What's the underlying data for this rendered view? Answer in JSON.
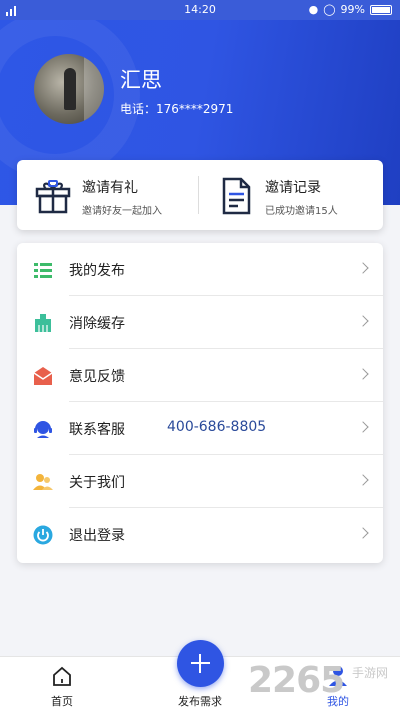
{
  "status_bar": {
    "time": "14:20",
    "battery": "99%"
  },
  "profile": {
    "name": "汇思",
    "phone": "电话：176****2971"
  },
  "invite": [
    {
      "title": "邀请有礼",
      "subtitle": "邀请好友一起加入",
      "icon": "gift-icon"
    },
    {
      "title": "邀请记录",
      "subtitle": "已成功邀请15人",
      "icon": "document-icon"
    }
  ],
  "menu": [
    {
      "label": "我的发布",
      "icon": "list-icon",
      "color": "#3dbb6a"
    },
    {
      "label": "消除缓存",
      "icon": "broom-icon",
      "color": "#3cbf9a"
    },
    {
      "label": "意见反馈",
      "icon": "mail-icon",
      "color": "#e8604c"
    },
    {
      "label": "联系客服",
      "value": "400-686-8805",
      "icon": "headset-icon",
      "color": "#2f55e3"
    },
    {
      "label": "关于我们",
      "icon": "people-icon",
      "color": "#f3b43b"
    },
    {
      "label": "退出登录",
      "icon": "power-icon",
      "color": "#2aa8e0"
    }
  ],
  "tabbar": {
    "home": "首页",
    "publish": "发布需求",
    "mine": "我的",
    "accent": "#2f55e3"
  },
  "watermark": {
    "brand": "2265",
    "sub": "手游网"
  }
}
